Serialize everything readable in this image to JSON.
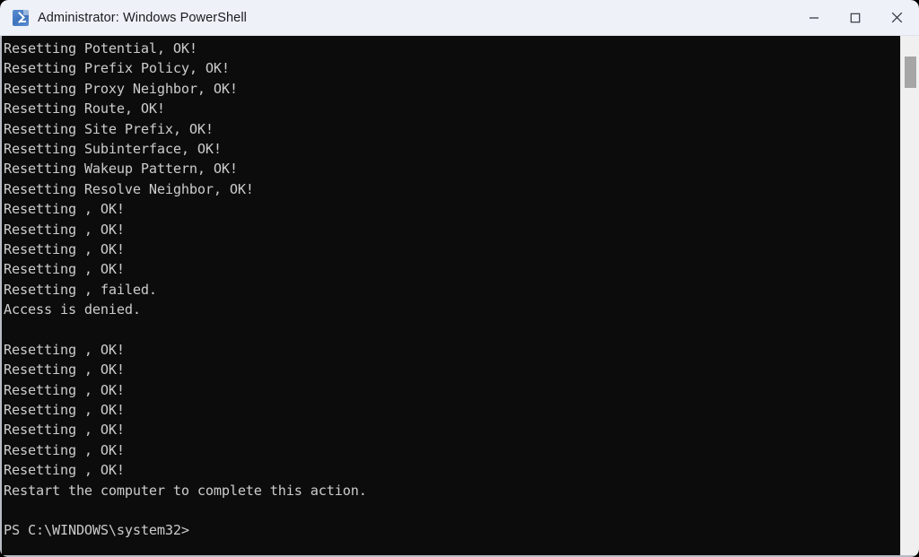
{
  "window": {
    "title": "Administrator: Windows PowerShell",
    "app_icon": "powershell-icon",
    "colors": {
      "titlebar_background": "#eef1f8",
      "titlebar_text": "#1b1b1f",
      "console_background": "#0c0c0c",
      "console_text": "#cccccc",
      "window_border": "#b9bcc4",
      "scrollbar_track": "#f0f0f0",
      "scrollbar_thumb": "#a6a6a6"
    },
    "controls": {
      "minimize": "minimize-button",
      "maximize": "maximize-button",
      "close": "close-button"
    }
  },
  "console": {
    "prompt": "PS C:\\WINDOWS\\system32>",
    "lines": [
      "Resetting Potential, OK!",
      "Resetting Prefix Policy, OK!",
      "Resetting Proxy Neighbor, OK!",
      "Resetting Route, OK!",
      "Resetting Site Prefix, OK!",
      "Resetting Subinterface, OK!",
      "Resetting Wakeup Pattern, OK!",
      "Resetting Resolve Neighbor, OK!",
      "Resetting , OK!",
      "Resetting , OK!",
      "Resetting , OK!",
      "Resetting , OK!",
      "Resetting , failed.",
      "Access is denied.",
      "",
      "Resetting , OK!",
      "Resetting , OK!",
      "Resetting , OK!",
      "Resetting , OK!",
      "Resetting , OK!",
      "Resetting , OK!",
      "Resetting , OK!",
      "Restart the computer to complete this action.",
      "",
      "PS C:\\WINDOWS\\system32>"
    ]
  },
  "scrollbar": {
    "thumb_top_percent": 4,
    "thumb_height_percent": 6
  }
}
